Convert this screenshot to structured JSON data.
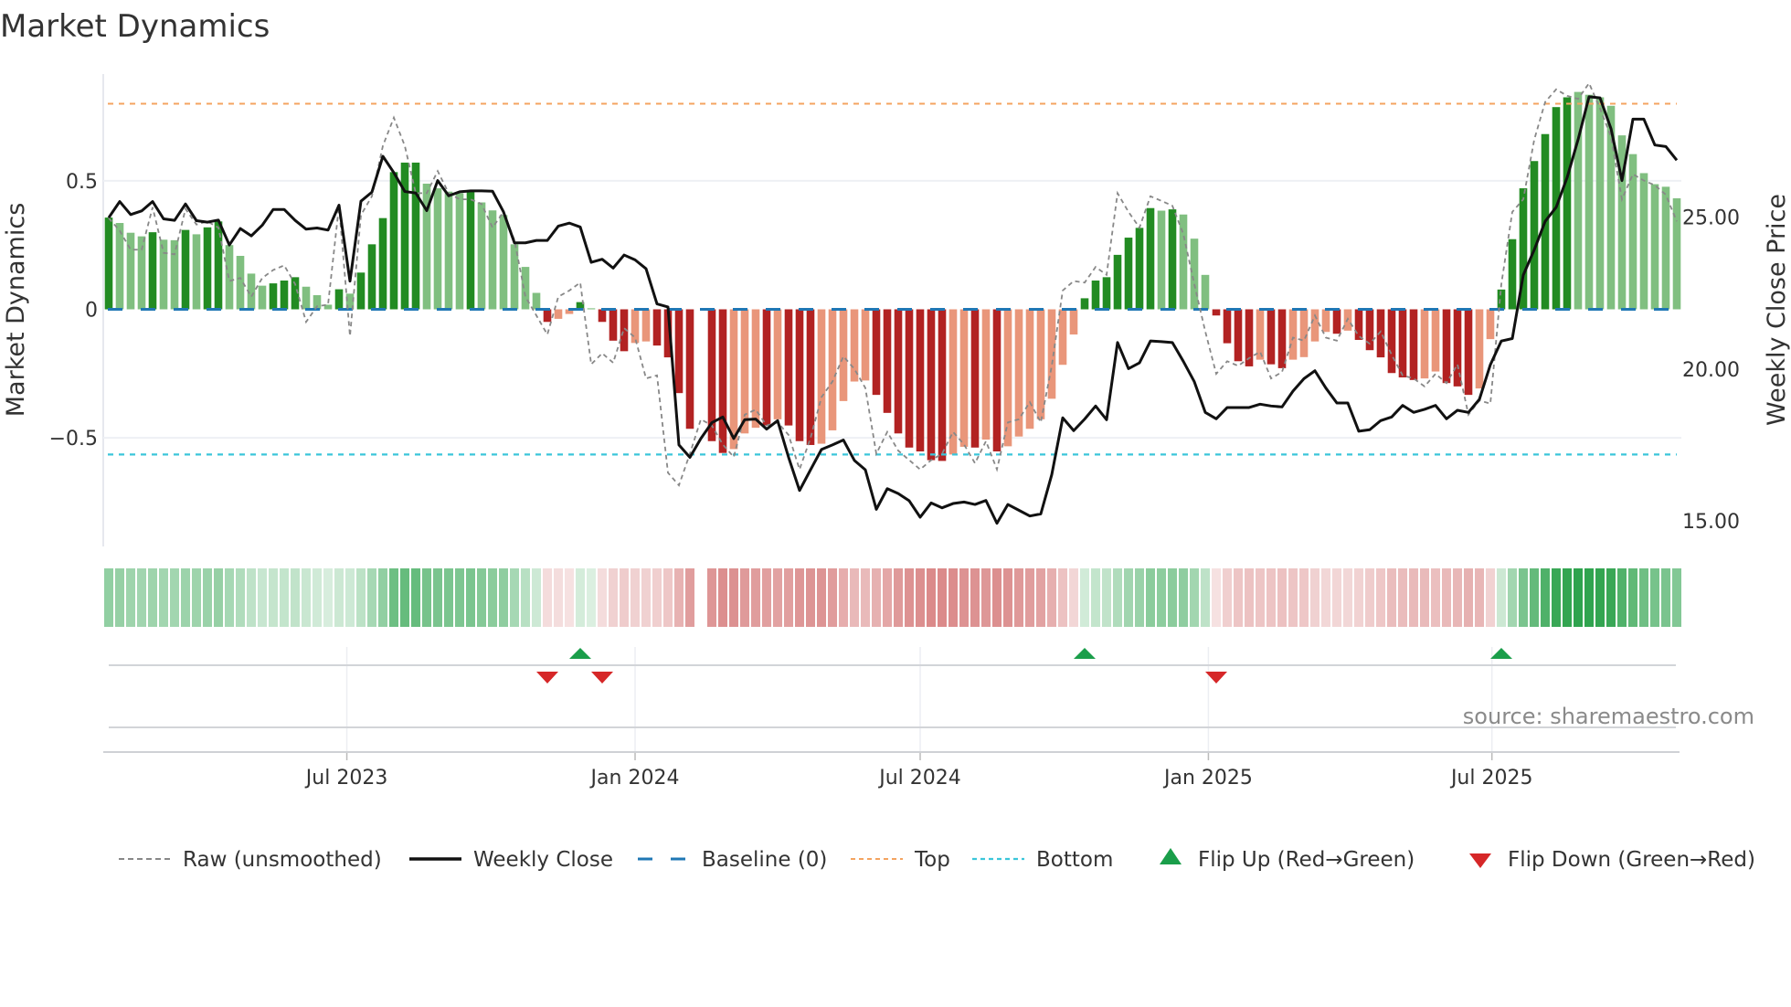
{
  "chart_data": {
    "type": "bar",
    "title": "Market Dynamics",
    "ylabel": "Market Dynamics",
    "y2label": "Weekly Close Price",
    "ylim": [
      -0.92,
      0.92
    ],
    "y2lim": [
      14.16,
      29.71
    ],
    "yticks": [
      {
        "v": 0.5,
        "label": "0.5"
      },
      {
        "v": 0,
        "label": "0"
      },
      {
        "v": -0.5,
        "label": "−0.5"
      }
    ],
    "y2ticks": [
      {
        "v": 25,
        "label": "25.00"
      },
      {
        "v": 20,
        "label": "20.00"
      },
      {
        "v": 15,
        "label": "15.00"
      }
    ],
    "xticks": [
      {
        "date": "2023-07-01",
        "label": "Jul 2023"
      },
      {
        "date": "2024-01-01",
        "label": "Jan 2024"
      },
      {
        "date": "2024-07-01",
        "label": "Jul 2024"
      },
      {
        "date": "2025-01-01",
        "label": "Jan 2025"
      },
      {
        "date": "2025-07-01",
        "label": "Jul 2025"
      }
    ],
    "start_week": "2023-01-30",
    "frequency": "weekly",
    "top_level": 0.8,
    "bottom_level": -0.565,
    "baseline": 0,
    "values": [
      0.357,
      0.336,
      0.298,
      0.284,
      0.3,
      0.271,
      0.269,
      0.309,
      0.292,
      0.319,
      0.342,
      0.25,
      0.208,
      0.139,
      0.092,
      0.101,
      0.112,
      0.125,
      0.088,
      0.055,
      0.018,
      0.078,
      0.061,
      0.143,
      0.253,
      0.355,
      0.534,
      0.571,
      0.571,
      0.489,
      0.471,
      0.458,
      0.452,
      0.458,
      0.416,
      0.385,
      0.367,
      0.253,
      0.165,
      0.064,
      -0.049,
      -0.037,
      -0.018,
      0.028,
      0.004,
      -0.049,
      -0.122,
      -0.163,
      -0.131,
      -0.125,
      -0.141,
      -0.187,
      -0.326,
      -0.465,
      null,
      -0.513,
      -0.559,
      -0.544,
      -0.483,
      -0.461,
      -0.452,
      -0.428,
      -0.452,
      -0.513,
      -0.528,
      -0.523,
      -0.471,
      -0.357,
      -0.281,
      -0.277,
      -0.333,
      -0.403,
      -0.483,
      -0.538,
      -0.553,
      -0.587,
      -0.59,
      -0.565,
      -0.535,
      -0.538,
      -0.507,
      -0.553,
      -0.533,
      -0.495,
      -0.465,
      -0.428,
      -0.348,
      -0.216,
      -0.098,
      0.043,
      0.112,
      0.125,
      0.212,
      0.279,
      0.317,
      0.394,
      0.384,
      0.389,
      0.369,
      0.275,
      0.134,
      -0.024,
      -0.132,
      -0.202,
      -0.222,
      -0.196,
      -0.214,
      -0.229,
      -0.196,
      -0.186,
      -0.125,
      -0.088,
      -0.095,
      -0.083,
      -0.119,
      -0.159,
      -0.187,
      -0.248,
      -0.265,
      -0.275,
      -0.269,
      -0.242,
      -0.287,
      -0.3,
      -0.333,
      -0.308,
      -0.116,
      0.077,
      0.273,
      0.471,
      0.577,
      0.682,
      0.787,
      0.825,
      0.846,
      0.835,
      0.825,
      0.792,
      0.677,
      0.604,
      0.53,
      0.487,
      0.477,
      0.432
    ],
    "strong": "100010010110000111000101111110000100000010010111001111011000101110000011111110010100000001111111010001111011000010111111001110011111110000000000",
    "raw": [
      0.355,
      0.306,
      0.232,
      0.232,
      0.397,
      0.22,
      0.214,
      0.391,
      0.33,
      0.342,
      0.318,
      0.11,
      0.122,
      0.049,
      0.122,
      0.153,
      0.171,
      0.098,
      -0.049,
      0.012,
      0.018,
      0.403,
      -0.104,
      0.367,
      0.44,
      0.636,
      0.746,
      0.636,
      0.452,
      0.452,
      0.538,
      0.452,
      0.428,
      0.428,
      0.41,
      0.318,
      0.379,
      0.269,
      0.049,
      -0.024,
      -0.098,
      0.049,
      0.073,
      0.104,
      -0.214,
      -0.171,
      -0.208,
      -0.073,
      -0.11,
      -0.269,
      -0.257,
      -0.636,
      -0.685,
      -0.562,
      -0.428,
      -0.452,
      -0.526,
      -0.575,
      -0.41,
      -0.39,
      -0.452,
      -0.44,
      -0.489,
      -0.623,
      -0.501,
      -0.342,
      -0.281,
      -0.183,
      -0.232,
      -0.306,
      -0.562,
      -0.477,
      -0.55,
      -0.587,
      -0.623,
      -0.587,
      -0.562,
      -0.477,
      -0.526,
      -0.599,
      -0.513,
      -0.623,
      -0.44,
      -0.428,
      -0.361,
      -0.44,
      -0.22,
      0.073,
      0.11,
      0.104,
      0.165,
      0.134,
      0.452,
      0.379,
      0.318,
      0.44,
      0.422,
      0.403,
      0.293,
      0.098,
      -0.086,
      -0.251,
      -0.202,
      -0.22,
      -0.19,
      -0.165,
      -0.269,
      -0.244,
      -0.11,
      -0.122,
      -0.024,
      -0.11,
      -0.122,
      -0.037,
      -0.104,
      -0.134,
      -0.086,
      -0.177,
      -0.257,
      -0.269,
      -0.3,
      -0.251,
      -0.287,
      -0.214,
      -0.41,
      -0.355,
      -0.367,
      0.098,
      0.379,
      0.428,
      0.66,
      0.807,
      0.856,
      0.831,
      0.819,
      0.88,
      0.782,
      0.672,
      0.428,
      0.526,
      0.501,
      0.483,
      0.446,
      0.342
    ],
    "close": [
      24.98,
      25.51,
      25.08,
      25.2,
      25.51,
      24.94,
      24.89,
      25.43,
      24.88,
      24.83,
      24.9,
      24.08,
      24.62,
      24.38,
      24.73,
      25.25,
      25.25,
      24.89,
      24.6,
      24.64,
      24.57,
      25.39,
      22.89,
      25.52,
      25.82,
      27.0,
      26.46,
      25.84,
      25.79,
      25.21,
      26.2,
      25.7,
      25.83,
      25.86,
      25.86,
      25.85,
      25.17,
      24.15,
      24.15,
      24.23,
      24.23,
      24.7,
      24.8,
      24.67,
      23.51,
      23.61,
      23.32,
      23.75,
      23.59,
      23.3,
      22.14,
      22.04,
      17.5,
      17.09,
      17.71,
      18.23,
      18.42,
      17.71,
      18.33,
      18.35,
      18.02,
      18.3,
      17.09,
      16.0,
      16.68,
      17.35,
      17.5,
      17.66,
      16.99,
      16.68,
      15.38,
      16.06,
      15.9,
      15.66,
      15.12,
      15.59,
      15.43,
      15.57,
      15.62,
      15.54,
      15.67,
      14.92,
      15.54,
      15.35,
      15.16,
      15.23,
      16.52,
      18.39,
      17.97,
      18.35,
      18.78,
      18.33,
      20.87,
      20.01,
      20.2,
      20.92,
      20.9,
      20.87,
      20.25,
      19.58,
      18.57,
      18.36,
      18.73,
      18.73,
      18.73,
      18.84,
      18.78,
      18.75,
      19.27,
      19.68,
      19.94,
      19.37,
      18.88,
      18.88,
      17.95,
      18.0,
      18.3,
      18.42,
      18.8,
      18.57,
      18.67,
      18.8,
      18.36,
      18.64,
      18.57,
      19.0,
      20.14,
      20.92,
      21.0,
      23.09,
      23.92,
      24.86,
      25.32,
      26.3,
      27.55,
      28.96,
      28.92,
      27.91,
      26.2,
      28.22,
      28.22,
      27.37,
      27.32,
      26.87
    ],
    "flips": [
      {
        "week": 41,
        "dir": "down"
      },
      {
        "week": 44,
        "dir": "up"
      },
      {
        "week": 46,
        "dir": "down"
      },
      {
        "week": 90,
        "dir": "up"
      },
      {
        "week": 102,
        "dir": "down"
      },
      {
        "week": 128,
        "dir": "up"
      }
    ],
    "legend": {
      "placement": "bottom",
      "items": [
        {
          "label": "Raw (unsmoothed)",
          "kind": "raw"
        },
        {
          "label": "Weekly Close",
          "kind": "close"
        },
        {
          "label": "Baseline (0)",
          "kind": "baseline"
        },
        {
          "label": "Top",
          "kind": "top"
        },
        {
          "label": "Bottom",
          "kind": "bottom"
        },
        {
          "label": "Flip Up (Red→Green)",
          "kind": "up"
        },
        {
          "label": "Flip Down (Green→Red)",
          "kind": "down"
        }
      ]
    },
    "source": "source: sharemaestro.com",
    "colors": {
      "pos_strong": "#228b22",
      "pos_weak": "#80bf80",
      "neg_strong": "#b22222",
      "neg_weak": "#e9967a",
      "close": "#111111",
      "raw": "#888888",
      "baseline": "#1f77b4",
      "top": "#f4a460",
      "bottom": "#3bc6da",
      "flip_up": "#1a9e4a",
      "flip_down": "#d62728"
    }
  }
}
